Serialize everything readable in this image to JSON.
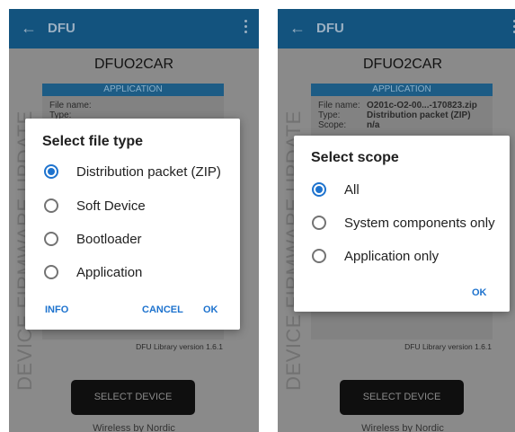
{
  "screens": [
    {
      "appbar": {
        "back_icon": "arrow-left-icon",
        "title": "DFU",
        "more_icon": "more-vert-icon"
      },
      "device_name": "DFUO2CAR",
      "card": {
        "header": "APPLICATION",
        "rows": [
          {
            "key": "File name:",
            "value": ""
          },
          {
            "key": "Type:",
            "value": ""
          }
        ]
      },
      "vertical_title": "DEVICE FIRMWARE UPDATE",
      "lib_version": "DFU Library version 1.6.1",
      "select_device": "SELECT DEVICE",
      "footer": "Wireless by Nordic",
      "dialog": {
        "title": "Select file type",
        "options": [
          {
            "label": "Distribution packet (ZIP)",
            "selected": true
          },
          {
            "label": "Soft Device",
            "selected": false
          },
          {
            "label": "Bootloader",
            "selected": false
          },
          {
            "label": "Application",
            "selected": false
          }
        ],
        "info_button": "INFO",
        "cancel_button": "CANCEL",
        "ok_button": "OK"
      }
    },
    {
      "appbar": {
        "back_icon": "arrow-left-icon",
        "title": "DFU",
        "more_icon": "more-vert-icon"
      },
      "device_name": "DFUO2CAR",
      "card": {
        "header": "APPLICATION",
        "rows": [
          {
            "key": "File name:",
            "value": "O201c-O2-00...-170823.zip"
          },
          {
            "key": "Type:",
            "value": "Distribution packet (ZIP)"
          },
          {
            "key": "Scope:",
            "value": "n/a"
          }
        ]
      },
      "vertical_title": "DEVICE FIRMWARE UPDATE",
      "lib_version": "DFU Library version 1.6.1",
      "select_device": "SELECT DEVICE",
      "footer": "Wireless by Nordic",
      "dialog": {
        "title": "Select scope",
        "options": [
          {
            "label": "All",
            "selected": true
          },
          {
            "label": "System components only",
            "selected": false
          },
          {
            "label": "Application only",
            "selected": false
          }
        ],
        "ok_button": "OK"
      }
    }
  ],
  "colors": {
    "appbar": "#13537e",
    "accent": "#1e73ce",
    "scrim_bg": "#8a8a8a"
  }
}
